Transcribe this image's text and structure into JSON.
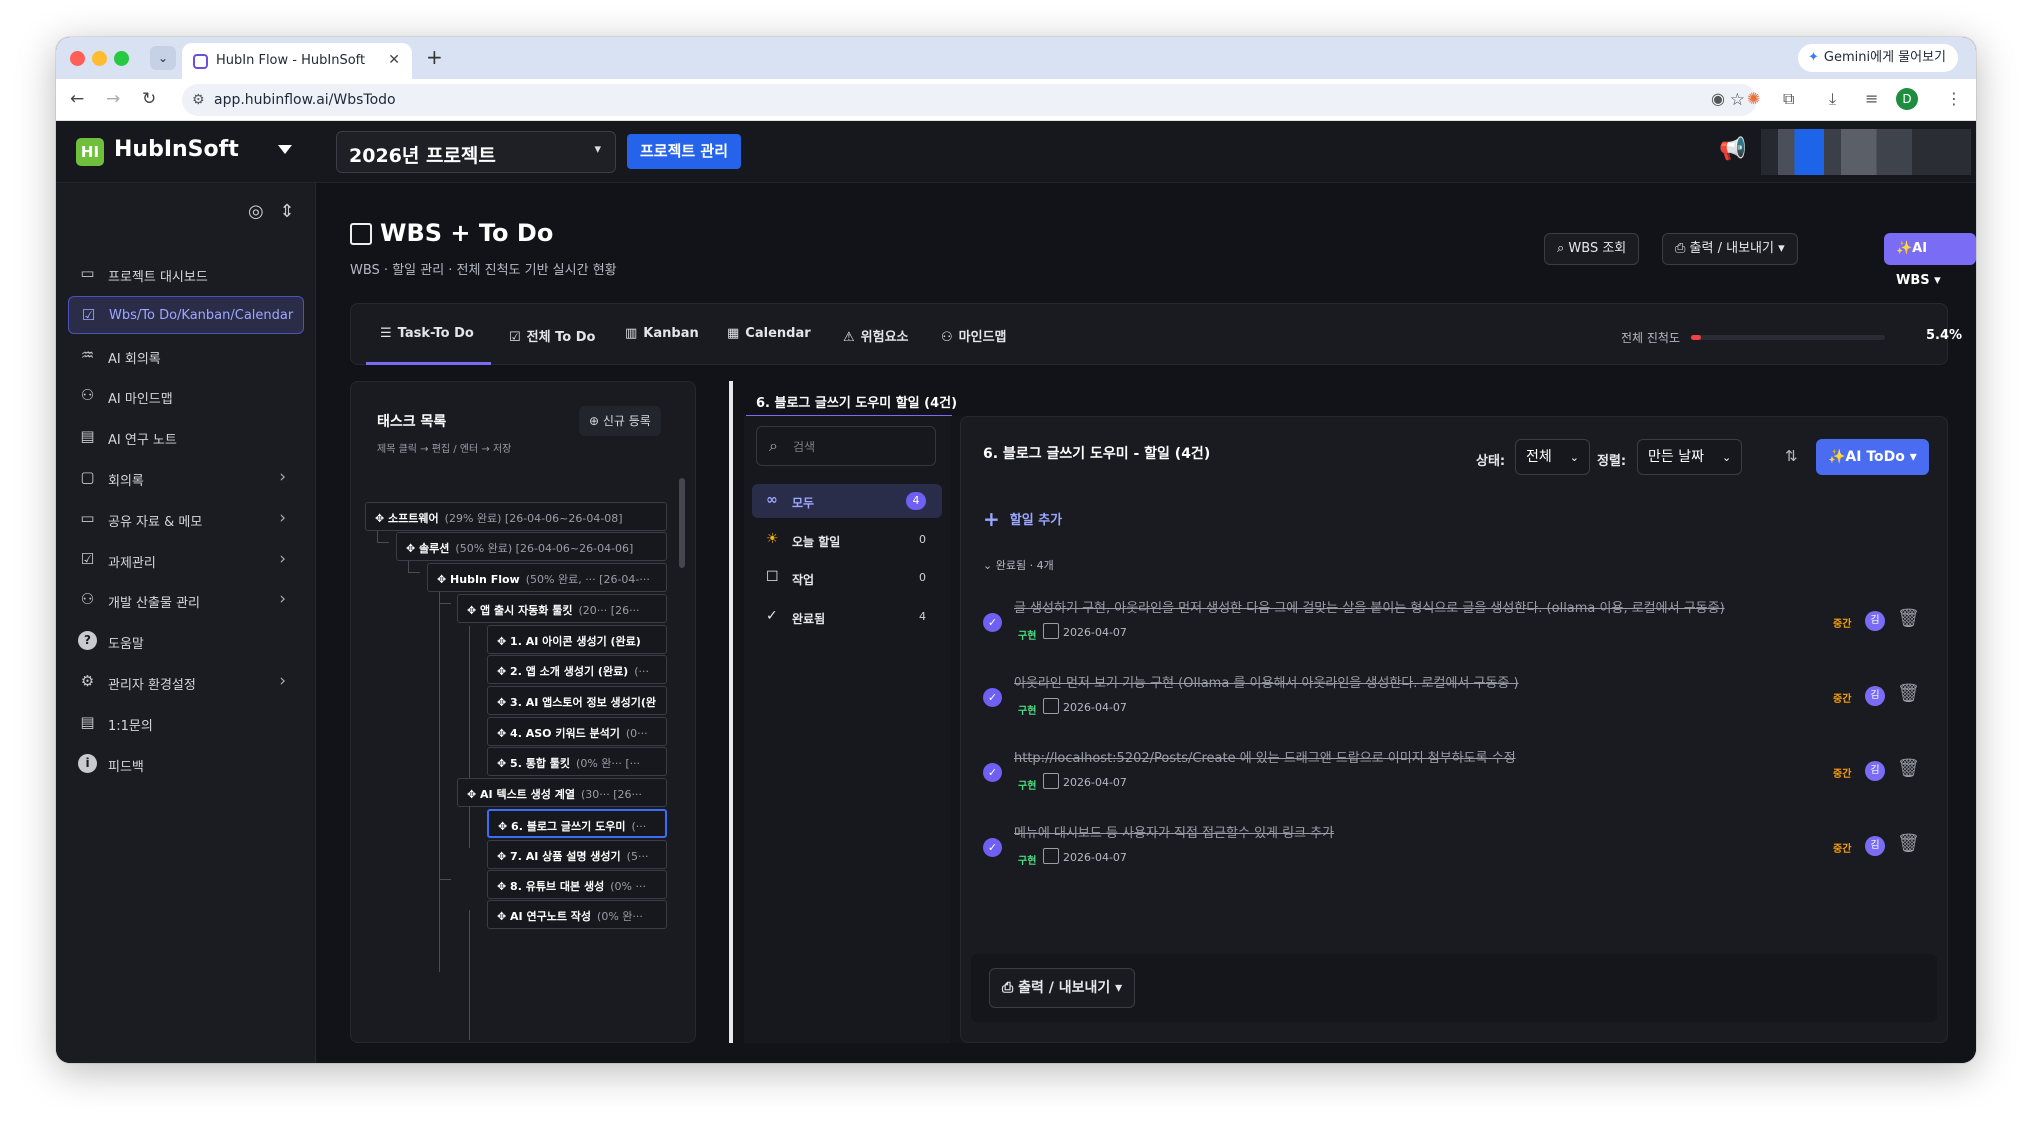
{
  "browser": {
    "tab_title": "HubIn Flow - HubInSoft",
    "gemini_label": "Gemini에게 물어보기",
    "url": "app.hubinflow.ai/WbsTodo",
    "profile_initial": "D"
  },
  "app": {
    "brand": "HubInSoft",
    "logo_text": "HI",
    "project_select": "2026년 프로젝트",
    "project_manage_button": "프로젝트 관리"
  },
  "sidebar": {
    "items": [
      {
        "label": "프로젝트 대시보드",
        "icon": "dashboard-icon",
        "chevron": false
      },
      {
        "label": "Wbs/To Do/Kanban/Calendar",
        "icon": "calendar-check-icon",
        "chevron": false,
        "active": true
      },
      {
        "label": "AI 회의록",
        "icon": "waveform-icon",
        "chevron": false
      },
      {
        "label": "AI 마인드맵",
        "icon": "mindmap-icon",
        "chevron": false
      },
      {
        "label": "AI 연구 노트",
        "icon": "note-icon",
        "chevron": false
      },
      {
        "label": "회의록",
        "icon": "chat-icon",
        "chevron": true
      },
      {
        "label": "공유 자료 & 메모",
        "icon": "folder-icon",
        "chevron": true
      },
      {
        "label": "과제관리",
        "icon": "task-icon",
        "chevron": true
      },
      {
        "label": "개발 산출물 관리",
        "icon": "hierarchy-icon",
        "chevron": true
      },
      {
        "label": "도움말",
        "icon": "help-icon",
        "chevron": false
      },
      {
        "label": "관리자 환경설정",
        "icon": "settings-icon",
        "chevron": true
      },
      {
        "label": "1:1문의",
        "icon": "message-icon",
        "chevron": false
      },
      {
        "label": "피드백",
        "icon": "info-icon",
        "chevron": false
      }
    ]
  },
  "page": {
    "title": "WBS + To Do",
    "subtitle": "WBS · 할일 관리 · 전체 진척도 기반 실시간 현황",
    "wbs_view_button": "WBS 조회",
    "export_button": "출력 / 내보내기",
    "ai_wbs_button": "✨AI WBS"
  },
  "view_tabs": [
    {
      "label": "Task-To Do",
      "icon": "list-icon"
    },
    {
      "label": "전체 To Do",
      "icon": "checkbox-icon"
    },
    {
      "label": "Kanban",
      "icon": "kanban-icon"
    },
    {
      "label": "Calendar",
      "icon": "calendar-icon"
    },
    {
      "label": "위험요소",
      "icon": "warning-icon"
    },
    {
      "label": "마인드맵",
      "icon": "mindmap-icon"
    }
  ],
  "progress": {
    "label": "전체 진척도",
    "value_text": "5.4%",
    "fraction": 0.054
  },
  "task_list": {
    "title": "태스크 목록",
    "new_button": "신규 등록",
    "hint": "제목 클릭 → 편집 / 엔터 → 저장",
    "nodes": [
      {
        "label": "소프트웨어",
        "meta": "(29% 완료)  [26-04-06~26-04-08]"
      },
      {
        "label": "솔루션",
        "meta": "(50% 완료)  [26-04-06~26-04-06]"
      },
      {
        "label": "HubIn Flow",
        "meta": "(50% 완료, ···  [26-04-···"
      },
      {
        "label": "앱 출시 자동화 툴킷",
        "meta": "(20···  [26···"
      },
      {
        "label": "1. AI 아이콘 생성기 (완료)",
        "meta": ""
      },
      {
        "label": "2. 앱 소개 생성기 (완료)",
        "meta": "(···"
      },
      {
        "label": "3. AI 앱스토어 정보 생성기(완",
        "meta": ""
      },
      {
        "label": "4. ASO 키워드 분석기",
        "meta": "(0···"
      },
      {
        "label": "5. 통합 툴킷",
        "meta": "(0% 완···  [···"
      },
      {
        "label": "AI 텍스트 생성 계열",
        "meta": "(30···  [26···"
      },
      {
        "label": "6. 블로그 글쓰기 도우미",
        "meta": "(···"
      },
      {
        "label": "7. AI 상품 설명 생성기",
        "meta": "(5···"
      },
      {
        "label": "8. 유튜브 대본 생성",
        "meta": "(0% ···"
      },
      {
        "label": "AI 연구노트 작성",
        "meta": "(0% 완···"
      }
    ]
  },
  "detail": {
    "tab_label": "6. 블로그 글쓰기 도우미 할일 (4건)",
    "search_placeholder": "검색",
    "filters": [
      {
        "label": "모두",
        "count": "4",
        "icon": "infinity-icon"
      },
      {
        "label": "오늘 할일",
        "count": "0",
        "icon": "sun-icon"
      },
      {
        "label": "작업",
        "count": "0",
        "icon": "square-icon"
      },
      {
        "label": "완료됨",
        "count": "4",
        "icon": "check-icon"
      }
    ],
    "title": "6. 블로그 글쓰기 도우미 - 할일 (4건)",
    "status_label": "상태:",
    "status_value": "전체",
    "sort_label": "정렬:",
    "sort_value": "만든 날짜",
    "ai_todo_button": "✨AI ToDo",
    "add_label": "할일 추가",
    "done_header": "완료됨 · 4개",
    "todos": [
      {
        "text": "글 생성하기 구현, 아웃라인을 먼저 생성한 다음 그에 걸맞는 살을 붙이는 형식으로 글을 생성한다. (ollama 이용, 로컬에서 구동중)",
        "tag": "구현",
        "date": "2026-04-07",
        "priority": "중간",
        "assignee": "김"
      },
      {
        "text": "아웃라인 먼저 보기 기능 구현 (Ollama 를 이용해서 아웃라인을 생성한다. 로컬에서 구동중 )",
        "tag": "구현",
        "date": "2026-04-07",
        "priority": "중간",
        "assignee": "김"
      },
      {
        "text": "http://localhost:5202/Posts/Create 에 있는 드래그앤 드랍으로 이미지 첨부하도록 수정",
        "tag": "구현",
        "date": "2026-04-07",
        "priority": "중간",
        "assignee": "김"
      },
      {
        "text": "메뉴에 대시보드 등 사용자가 직접 접근할수 있게 링크 추가",
        "tag": "구현",
        "date": "2026-04-07",
        "priority": "중간",
        "assignee": "김"
      }
    ],
    "export_button": "출력 / 내보내기"
  },
  "colors": {
    "accent": "#7b6cf6",
    "primary_blue": "#2563eb",
    "progress_red": "#ef4444",
    "tag_green": "#4ade80",
    "priority_orange": "#f59e0b"
  }
}
